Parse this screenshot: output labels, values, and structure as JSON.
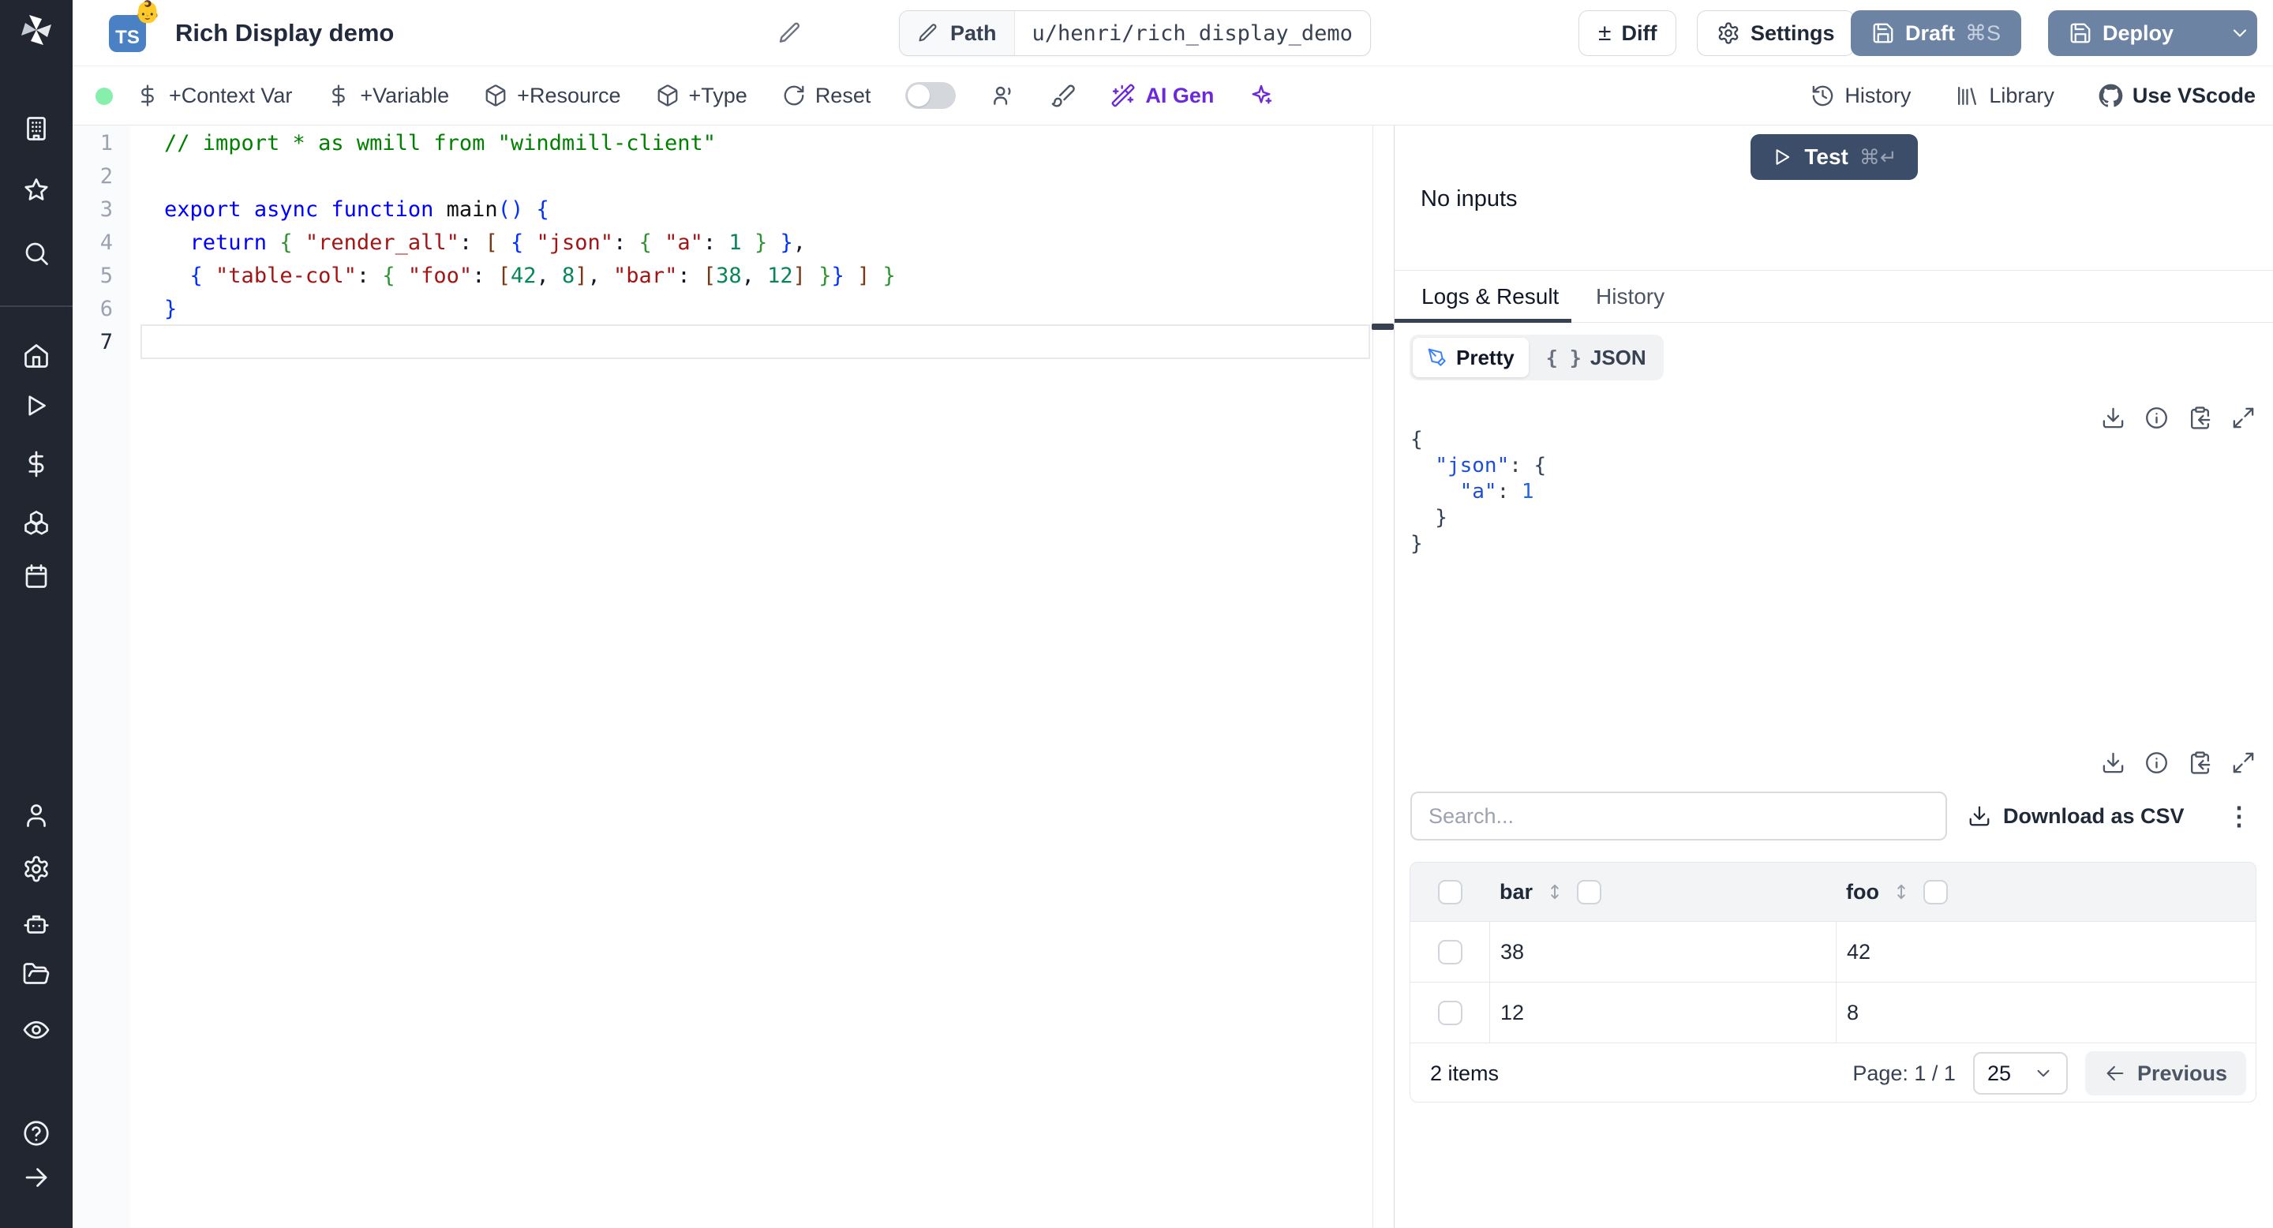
{
  "header": {
    "lang_badge": "TS",
    "badge_emoji": "👶",
    "title": "Rich Display demo",
    "path_label": "Path",
    "path_value": "u/henri/rich_display_demo",
    "diff_label": "Diff",
    "diff_glyph": "±",
    "settings_label": "Settings",
    "draft_label": "Draft",
    "draft_shortcut": "⌘S",
    "deploy_label": "Deploy"
  },
  "toolbar": {
    "left_items": [
      {
        "icon": "dollar",
        "label": "+Context Var"
      },
      {
        "icon": "dollar",
        "label": "+Variable"
      },
      {
        "icon": "package",
        "label": "+Resource"
      },
      {
        "icon": "package",
        "label": "+Type"
      },
      {
        "icon": "reset",
        "label": "Reset"
      }
    ],
    "ai_label": "AI Gen",
    "right_items": [
      {
        "icon": "history",
        "label": "History"
      },
      {
        "icon": "library",
        "label": "Library"
      },
      {
        "icon": "github",
        "label": "Use VScode"
      }
    ]
  },
  "editor": {
    "active_line": 7,
    "lines": [
      {
        "n": 1,
        "tokens": [
          [
            "cm",
            "// import * as wmill from \"windmill-client\""
          ]
        ]
      },
      {
        "n": 2,
        "tokens": []
      },
      {
        "n": 3,
        "tokens": [
          [
            "kw",
            "export"
          ],
          [
            "pl",
            " "
          ],
          [
            "kw",
            "async"
          ],
          [
            "pl",
            " "
          ],
          [
            "kw",
            "function"
          ],
          [
            "fn",
            " main"
          ],
          [
            "b1",
            "()"
          ],
          [
            "pl",
            " "
          ],
          [
            "b1",
            "{"
          ]
        ]
      },
      {
        "n": 4,
        "tokens": [
          [
            "pl",
            "  "
          ],
          [
            "kw",
            "return"
          ],
          [
            "pl",
            " "
          ],
          [
            "b2",
            "{"
          ],
          [
            "pl",
            " "
          ],
          [
            "str",
            "\"render_all\""
          ],
          [
            "pl",
            ": "
          ],
          [
            "b3",
            "["
          ],
          [
            "pl",
            " "
          ],
          [
            "b1",
            "{"
          ],
          [
            "pl",
            " "
          ],
          [
            "str",
            "\"json\""
          ],
          [
            "pl",
            ": "
          ],
          [
            "b2",
            "{"
          ],
          [
            "pl",
            " "
          ],
          [
            "str",
            "\"a\""
          ],
          [
            "pl",
            ": "
          ],
          [
            "num",
            "1"
          ],
          [
            "pl",
            " "
          ],
          [
            "b2",
            "}"
          ],
          [
            "pl",
            " "
          ],
          [
            "b1",
            "}"
          ],
          [
            "pl",
            ","
          ]
        ]
      },
      {
        "n": 5,
        "tokens": [
          [
            "pl",
            "  "
          ],
          [
            "b1",
            "{"
          ],
          [
            "pl",
            " "
          ],
          [
            "str",
            "\"table-col\""
          ],
          [
            "pl",
            ": "
          ],
          [
            "b2",
            "{"
          ],
          [
            "pl",
            " "
          ],
          [
            "str",
            "\"foo\""
          ],
          [
            "pl",
            ": "
          ],
          [
            "b3",
            "["
          ],
          [
            "num",
            "42"
          ],
          [
            "pl",
            ", "
          ],
          [
            "num",
            "8"
          ],
          [
            "b3",
            "]"
          ],
          [
            "pl",
            ", "
          ],
          [
            "str",
            "\"bar\""
          ],
          [
            "pl",
            ": "
          ],
          [
            "b3",
            "["
          ],
          [
            "num",
            "38"
          ],
          [
            "pl",
            ", "
          ],
          [
            "num",
            "12"
          ],
          [
            "b3",
            "]"
          ],
          [
            "pl",
            " "
          ],
          [
            "b2",
            "}"
          ],
          [
            "b1",
            "}"
          ],
          [
            "pl",
            " "
          ],
          [
            "b3",
            "]"
          ],
          [
            "pl",
            " "
          ],
          [
            "b2",
            "}"
          ]
        ]
      },
      {
        "n": 6,
        "tokens": [
          [
            "b1",
            "}"
          ]
        ]
      },
      {
        "n": 7,
        "tokens": []
      }
    ]
  },
  "run_panel": {
    "test_label": "Test",
    "test_shortcut": "⌘↵",
    "no_inputs": "No inputs",
    "tabs": [
      "Logs & Result",
      "History"
    ],
    "active_tab": "Logs & Result"
  },
  "result": {
    "view_modes": [
      "Pretty",
      "JSON"
    ],
    "active_mode": "Pretty",
    "braces_glyph": "{ }",
    "json_lines": [
      [
        [
          "jp",
          "{"
        ]
      ],
      [
        [
          "jp",
          "  "
        ],
        [
          "jk",
          "\"json\""
        ],
        [
          "jp",
          ": {"
        ]
      ],
      [
        [
          "jp",
          "    "
        ],
        [
          "jk",
          "\"a\""
        ],
        [
          "jp",
          ": "
        ],
        [
          "jn",
          "1"
        ]
      ],
      [
        [
          "jp",
          "  }"
        ]
      ],
      [
        [
          "jp",
          "}"
        ]
      ]
    ]
  },
  "table": {
    "search_placeholder": "Search...",
    "download_label": "Download as CSV",
    "kebab_glyph": "⋮",
    "columns": [
      "bar",
      "foo"
    ],
    "rows": [
      [
        "38",
        "42"
      ],
      [
        "12",
        "8"
      ]
    ],
    "items_text": "2 items",
    "page_text": "Page: 1 / 1",
    "page_size": "25",
    "previous_label": "Previous"
  },
  "sidebar": {
    "icons": [
      "building",
      "star",
      "search",
      "home",
      "play",
      "dollar",
      "boxes",
      "calendar",
      "user",
      "settings",
      "bot",
      "folder",
      "eye",
      "help",
      "arrow-right"
    ]
  },
  "colors": {
    "slate_button": "#6c83a4",
    "test_button": "#3b4d68",
    "ai_purple": "#6d28d9",
    "status_green": "#86efac",
    "sidebar_bg": "#212631"
  }
}
